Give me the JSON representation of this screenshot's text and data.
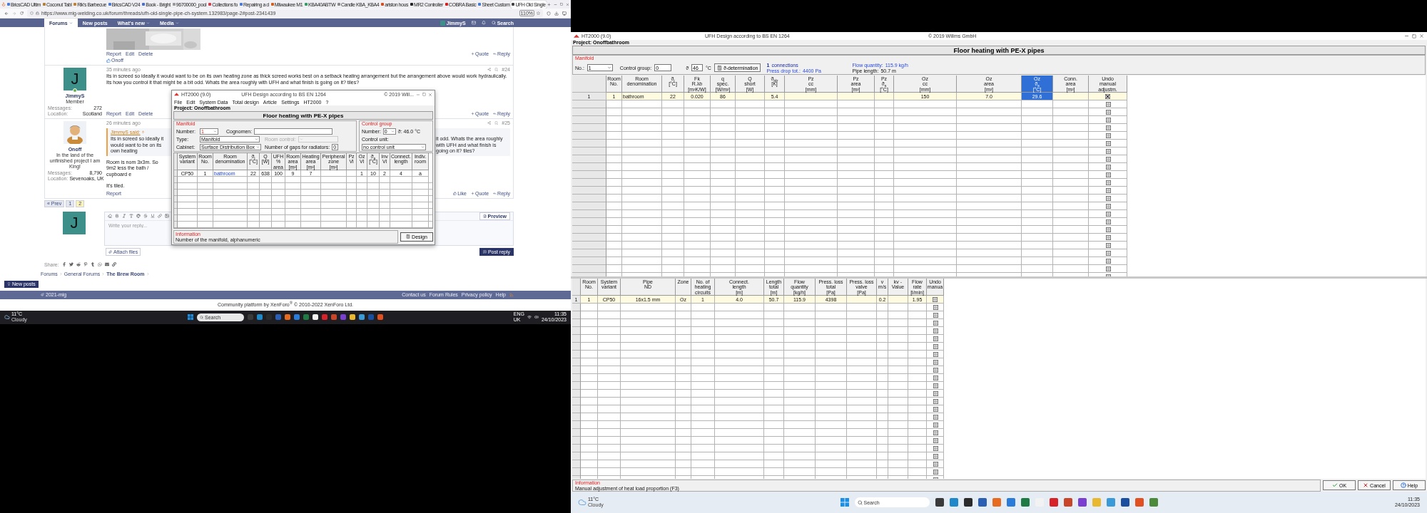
{
  "left_screen": {
    "browser": {
      "tabs": [
        {
          "label": "BricsCAD Ultim",
          "selected": false
        },
        {
          "label": "Coconut Tabl",
          "selected": false
        },
        {
          "label": "Rik's Barbecue",
          "selected": false
        },
        {
          "label": "BricsCAD V24",
          "selected": false
        },
        {
          "label": "Book - Bright",
          "selected": false
        },
        {
          "label": "96700000_pool",
          "selected": false
        },
        {
          "label": "Collections fo",
          "selected": false
        },
        {
          "label": "Repairing a d",
          "selected": false
        },
        {
          "label": "Milwaukee M1",
          "selected": false
        },
        {
          "label": "KBA40ABTW",
          "selected": false
        },
        {
          "label": "Candle KBA_KBA4",
          "selected": false
        },
        {
          "label": "ariston hous",
          "selected": false
        },
        {
          "label": "MR2 Controller",
          "selected": false
        },
        {
          "label": "COBRA Basic",
          "selected": false
        },
        {
          "label": "Sheet Custom",
          "selected": false
        },
        {
          "label": "UFH Old Single",
          "selected": true
        }
      ],
      "address": "https://www.mig-welding.co.uk/forum/threads/ufh-old-single-pipe-ch-system.132983/page-2#post-2341439",
      "zoom": "110%"
    },
    "nav": {
      "items": [
        {
          "label": "Forums",
          "selected": true,
          "dropdown": true
        },
        {
          "label": "New posts",
          "selected": false,
          "dropdown": false
        },
        {
          "label": "What's new",
          "selected": false,
          "dropdown": true
        },
        {
          "label": "Media",
          "selected": false,
          "dropdown": true
        }
      ],
      "user": "JimmyS",
      "search": "Search"
    },
    "first_post": {
      "actions": [
        "Report",
        "Edit",
        "Delete"
      ],
      "quote": "Quote",
      "reply": "Reply",
      "reaction_user": "Onoff"
    },
    "post_24": {
      "avatar": "J",
      "name": "JimmyS",
      "role": "Member",
      "stats": [
        {
          "label": "Messages:",
          "value": "272"
        },
        {
          "label": "Location:",
          "value": "Scotland"
        }
      ],
      "time": "35 minutes ago",
      "number": "#24",
      "body": "Its in screed so ideally it would want to be on its own heating zone as thick screed works best on a setback heating arrangement but the arrangement above would work hydraulically. Its how you control it that might be a bit odd. Whats the area roughly with UFH and what finish is going on it? tiles?",
      "actions": [
        "Report",
        "Edit",
        "Delete"
      ],
      "quote": "Quote",
      "reply": "Reply"
    },
    "post_25": {
      "name": "Onoff",
      "title": "In the land of the unfinished project I am King!",
      "stats": [
        {
          "label": "Messages:",
          "value": "8,790"
        },
        {
          "label": "Location:",
          "value": "Sevenoaks, UK"
        }
      ],
      "time": "26 minutes ago",
      "number": "#25",
      "quote_author": "JimmyS said:",
      "quote_parts": [
        "Its in screed so ideally it would want to be on its own heating",
        "it odd. Whats the area roughly with UFH and what finish is going on it? tiles?"
      ],
      "body_parts": [
        "Room is nom 3x3m. So 9m2 less the bath / cupboard e",
        "It's tiled."
      ],
      "actions": [
        "Report"
      ],
      "like": "Like",
      "quote": "Quote",
      "reply": "Reply"
    },
    "pagination": {
      "prev": "« Prev",
      "pages": [
        {
          "label": "1",
          "selected": false
        },
        {
          "label": "2",
          "selected": true
        }
      ]
    },
    "editor": {
      "avatar": "J",
      "placeholder": "Write your reply...",
      "preview": "Preview",
      "attach": "Attach files",
      "post": "Post reply"
    },
    "share_label": "Share:",
    "breadcrumb": [
      "Forums",
      "General Forums",
      "The Brew Room"
    ],
    "new_posts": "New posts",
    "footer": {
      "left": "2021-mig",
      "links": [
        "Contact us",
        "Forum Rules",
        "Privacy policy",
        "Help"
      ]
    },
    "platform": "Community platform by XenForo$^{®}$ © 2010-2022 XenForo Ltd.",
    "taskbar": {
      "temp": "11°C",
      "weather": "Cloudy",
      "search": "Search",
      "lang": "ENG",
      "region": "UK",
      "time": "11:35",
      "date": "24/10/2023"
    }
  },
  "mini_window": {
    "title": "HT2000 (9.0)",
    "subtitle": "UFH Design according to BS EN 1264",
    "copyright": "© 2019 Will...",
    "menu": [
      "File",
      "Edit",
      "System Data",
      "Total design",
      "Article",
      "Settings",
      "HT2000",
      "?"
    ],
    "project": "Project: Onoffbathroom",
    "heading": "Floor heating with PE-X pipes",
    "manifold": {
      "legend": "Manifold",
      "number_label": "Number:",
      "number": "1",
      "cognomen_label": "Cognomen:",
      "type_label": "Type:",
      "type": "Manifold",
      "room_control": {
        "label": "Room control:",
        "disabled": true
      },
      "cabinet_label": "Cabinet:",
      "cabinet": "Surface Distribution Box",
      "gaps_label": "Number of gaps for radiators:",
      "gaps": "0"
    },
    "control_group": {
      "legend": "Control group",
      "number_label": "Number:",
      "number": "0",
      "temp": "ϑ: 46.0 °C",
      "unit_label": "Control unit:",
      "unit": "no control unit"
    },
    "table": {
      "columns": [
        {
          "header": "System\nvariant"
        },
        {
          "header": "Room\nNo."
        },
        {
          "header": "Room\ndenomination"
        },
        {
          "header": "ϑ$_{i}$\n[°C]"
        },
        {
          "header": "Q\n[W]"
        },
        {
          "header": "UFH\n%\narea"
        },
        {
          "header": "Room\narea\n[m²]"
        },
        {
          "header": "Heating\narea\n[m²]"
        },
        {
          "header": "Peripheral\nzone\n[m²]"
        },
        {
          "header": "Pz\nVl"
        },
        {
          "header": "Oz\nVl"
        },
        {
          "header": "ϑ$_{s}$\n[°C]"
        },
        {
          "header": "Inv\nVl"
        },
        {
          "header": "Connect.\nlength"
        },
        {
          "header": "Indiv.\nroom"
        }
      ],
      "rows": [
        {
          "cells": [
            "CP50",
            "1",
            "bathroom",
            "22",
            "638",
            "100",
            "9",
            "7",
            "",
            "",
            "1",
            "10",
            "2",
            "4",
            "a"
          ]
        }
      ]
    },
    "info_label": "Information",
    "info_text": "Number of the manifold, alphanumeric",
    "design_button": "Design"
  },
  "right_screen": {
    "window": {
      "title": "HT2000 (9.0)",
      "subtitle": "UFH Design according to BS EN 1264",
      "copyright": "© 2019 Willms GmbH"
    },
    "project": "Project: Onoffbathroom",
    "heading": "Floor heating with PE-X pipes",
    "manifold": {
      "legend": "Manifold",
      "no_label": "No.:",
      "no_value": "1",
      "control_group_label": "Control group:",
      "control_group_value": "0",
      "temp_symbol": "ϑ",
      "temp_value": "46",
      "temp_unit": "°C",
      "determination_button": "ϑ-determination",
      "connections_count": "1",
      "connections_label": "connections",
      "press_drop_label": "Press drop tot.:",
      "press_drop_value": "4400 Pa",
      "flow_label": "Flow quantity:",
      "flow_value": "115.9 kg/h",
      "pipe_length_label": "Pipe length:",
      "pipe_length_value": "50.7 m"
    },
    "room_table": {
      "columns": [
        {
          "kind": "corner"
        },
        {
          "kind": "data",
          "header": "Room\nNo.",
          "selected": false
        },
        {
          "kind": "data",
          "header": "Room\ndenomination",
          "selected": false
        },
        {
          "kind": "data",
          "header": "ϑ$_{i}$\n[°C]",
          "selected": false
        },
        {
          "kind": "data",
          "header": "Fk\nR.λb\n[m²K/W]",
          "selected": false
        },
        {
          "kind": "data",
          "header": "q\nspec.\n[W/m²]",
          "selected": false
        },
        {
          "kind": "data",
          "header": "Q\nshort\n[W]",
          "selected": false
        },
        {
          "kind": "data",
          "header": "ϑ$_{Hr}$\n[K]",
          "selected": false
        },
        {
          "kind": "data",
          "header": "Pz\ncc\n[mm]",
          "selected": false
        },
        {
          "kind": "data",
          "header": "Pz\narea\n[m²]",
          "selected": false
        },
        {
          "kind": "data",
          "header": "Pz\nϑ$_{s}$\n[°C]",
          "selected": false
        },
        {
          "kind": "data",
          "header": "Oz\ncc\n[mm]",
          "selected": false
        },
        {
          "kind": "data",
          "header": "Oz\narea\n[m²]",
          "selected": false
        },
        {
          "kind": "data",
          "header": "Oz\nϑ$_{s}$\n[°C]",
          "selected": true
        },
        {
          "kind": "data",
          "header": "Conn.\narea\n[m²]",
          "selected": false
        },
        {
          "kind": "checkbox",
          "header": "Undo\nmanual\nadjustm.",
          "selected": false
        }
      ],
      "rows": [
        {
          "cells": [
            "1",
            "1",
            "bathroom",
            "22",
            "0.020",
            "86",
            "",
            "5.4",
            "",
            "",
            "",
            "150",
            "7.0",
            "29.6",
            ""
          ],
          "undo_checked": true
        }
      ]
    },
    "circuit_table": {
      "columns": [
        {
          "kind": "corner"
        },
        {
          "kind": "data",
          "header": "Room\nNo.",
          "selected": false
        },
        {
          "kind": "data",
          "header": "System\nvariant",
          "selected": false
        },
        {
          "kind": "data",
          "header": "Pipe\nND",
          "selected": false
        },
        {
          "kind": "data",
          "header": "Zone",
          "selected": false
        },
        {
          "kind": "data",
          "header": "No. of\nheating\ncircuits",
          "selected": false
        },
        {
          "kind": "data",
          "header": "Connect.\nlength\n[m]",
          "selected": false
        },
        {
          "kind": "data",
          "header": "Length\ntotal\n[m]",
          "selected": false
        },
        {
          "kind": "data",
          "header": "Flow\nquantity\n[kg/h]",
          "selected": false
        },
        {
          "kind": "data",
          "header": "Press. loss\ntotal\n[Pa]",
          "selected": false
        },
        {
          "kind": "data",
          "header": "Press. loss\nvalve\n[Pa]",
          "selected": false
        },
        {
          "kind": "data",
          "header": "v\nm/s",
          "selected": false
        },
        {
          "kind": "data",
          "header": "kv -\nValue",
          "selected": false
        },
        {
          "kind": "data",
          "header": "Flow\nrate\n[l/min]",
          "selected": false
        },
        {
          "kind": "checkbox",
          "header": "Undo\nmanua",
          "selected": false
        }
      ],
      "rows": [
        {
          "cells": [
            "1",
            "1",
            "CP50",
            "16x1.5 mm",
            "Oz",
            "1",
            "4.0",
            "50.7",
            "115.9",
            "4398",
            "",
            "0.2",
            "",
            "1.95"
          ],
          "undo_checked": false
        }
      ]
    },
    "info": {
      "label": "Information",
      "text": "Manual adjustment of heat load proportion (F3)"
    },
    "buttons": [
      {
        "label": "OK",
        "kind": "ok"
      },
      {
        "label": "Cancel",
        "kind": "cancel"
      },
      {
        "label": "Help",
        "kind": "help"
      }
    ],
    "taskbar": {
      "temp": "11°C",
      "weather": "Cloudy",
      "search": "Search",
      "time": "11:35",
      "date": "24/10/2023"
    }
  }
}
